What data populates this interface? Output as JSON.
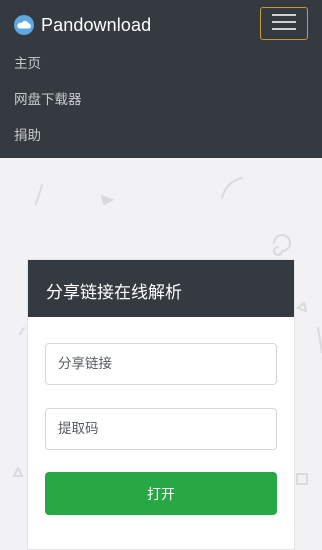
{
  "navbar": {
    "brand": "Pandownload",
    "brand_icon": "cloud-icon",
    "toggler_icon": "hamburger-menu-icon",
    "links": [
      "主页",
      "网盘下载器",
      "捐助"
    ],
    "colors": {
      "background": "#343a40",
      "toggler_border": "#c79a3b",
      "link": "#c8c9cb"
    }
  },
  "card": {
    "title": "分享链接在线解析",
    "share_link_placeholder": "分享链接",
    "extract_code_placeholder": "提取码",
    "open_button": "打开",
    "colors": {
      "header": "#343a40",
      "button": "#28a745"
    }
  }
}
